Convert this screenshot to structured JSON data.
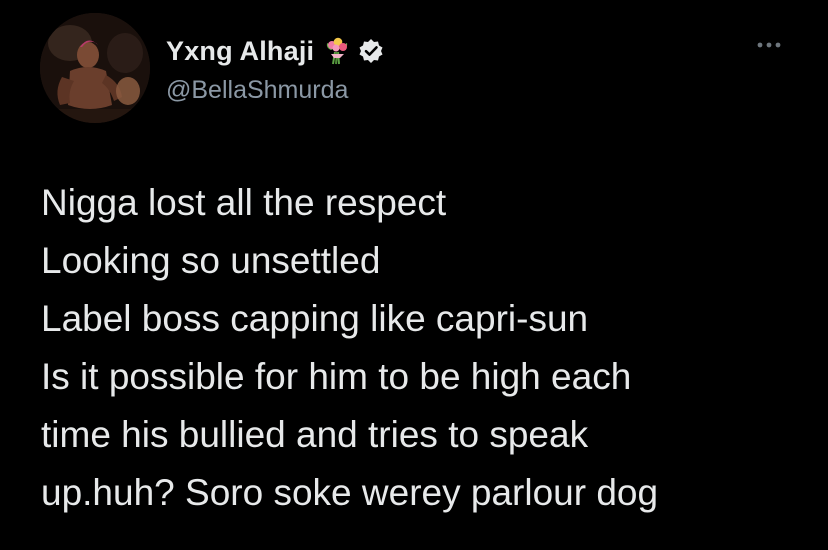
{
  "author": {
    "display_name": "Yxng Alhaji",
    "handle": "@BellaShmurda",
    "name_emoji": "bouquet-icon",
    "verified": true,
    "verified_icon": "verified-badge-icon",
    "avatar_icon": "profile-photo"
  },
  "menu": {
    "icon": "more-options-icon"
  },
  "tweet": {
    "lines": [
      "Nigga lost all the respect",
      "Looking so unsettled",
      "Label boss capping like capri-sun",
      "Is it possible for him to be high each",
      "time his bullied and tries to speak",
      "up.huh? Soro soke werey parlour dog"
    ]
  },
  "colors": {
    "background": "#000000",
    "text_primary": "#e7e9ea",
    "text_secondary": "#8b98a5"
  }
}
